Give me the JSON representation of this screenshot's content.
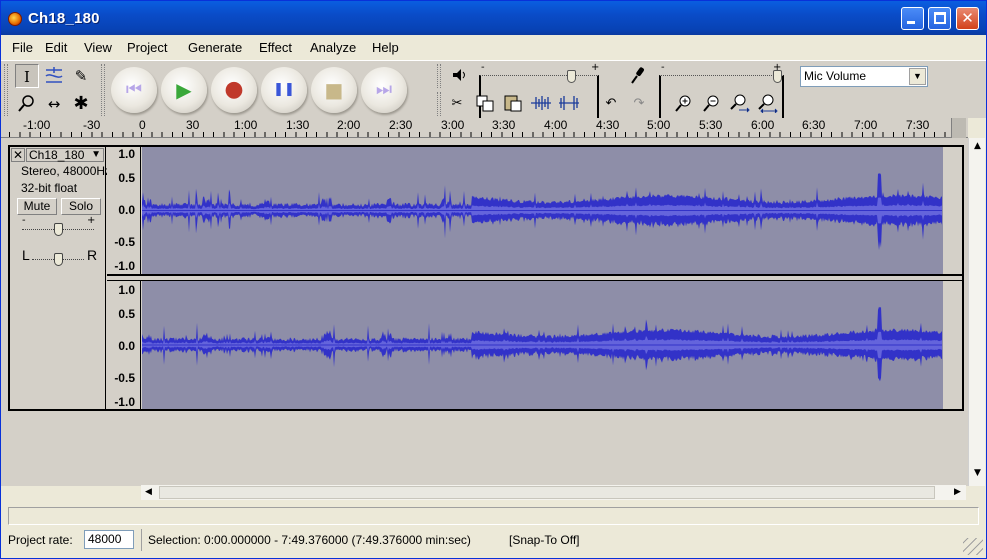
{
  "window": {
    "title": "Ch18_180",
    "app_icon": "audacity-icon",
    "controls": [
      "minimize",
      "maximize",
      "close"
    ]
  },
  "menu": [
    "File",
    "Edit",
    "View",
    "Project",
    "Generate",
    "Effect",
    "Analyze",
    "Help"
  ],
  "tools": [
    {
      "name": "selection-tool",
      "glyph": "I"
    },
    {
      "name": "envelope-tool",
      "glyph": "~"
    },
    {
      "name": "draw-tool",
      "glyph": "✎"
    },
    {
      "name": "zoom-tool",
      "glyph": "⚲"
    },
    {
      "name": "timeshift-tool",
      "glyph": "↔"
    },
    {
      "name": "multi-tool",
      "glyph": "✱"
    }
  ],
  "transport": [
    {
      "name": "skip-start",
      "glyph": "⏮",
      "color": "#b7a6e8"
    },
    {
      "name": "play",
      "glyph": "▶",
      "color": "#3aa83a"
    },
    {
      "name": "record",
      "glyph": "●",
      "color": "#c0392b"
    },
    {
      "name": "pause",
      "glyph": "❚❚",
      "color": "#3a56d8"
    },
    {
      "name": "stop",
      "glyph": "■",
      "color": "#c8b88a"
    },
    {
      "name": "skip-end",
      "glyph": "⏭",
      "color": "#b7a6e8"
    }
  ],
  "mixer": {
    "output_minus": "-",
    "output_plus": "+",
    "input_minus": "-",
    "input_plus": "+",
    "input_source": "Mic Volume",
    "output_level": 0.8,
    "input_level": 1.0
  },
  "edit_tools": [
    "cut-icon",
    "copy-icon",
    "paste-icon",
    "trim-icon",
    "silence-icon",
    "undo-icon",
    "redo-icon",
    "zoom-in-icon",
    "zoom-out-icon",
    "fit-selection-icon",
    "fit-project-icon"
  ],
  "ruler": {
    "labels": [
      "-1:00",
      "-30",
      "0",
      "30",
      "1:00",
      "1:30",
      "2:00",
      "2:30",
      "3:00",
      "3:30",
      "4:00",
      "4:30",
      "5:00",
      "5:30",
      "6:00",
      "6:30",
      "7:00",
      "7:30"
    ]
  },
  "track": {
    "name": "Ch18_180",
    "format": "Stereo, 48000Hz",
    "bits": "32-bit float",
    "mute": "Mute",
    "solo": "Solo",
    "gain_minus": "-",
    "gain_plus": "+",
    "pan_left": "L",
    "pan_right": "R",
    "gain_level": 0.5,
    "pan_level": 0.5,
    "amplitude_labels": [
      "1.0",
      "0.5",
      "0.0",
      "-0.5",
      "-1.0"
    ],
    "wave_color": "#3232c8",
    "wave_bg": "#8e8ea8"
  },
  "status": {
    "rate_label": "Project rate:",
    "rate_value": "48000",
    "selection": "Selection: 0:00.000000 - 7:49.376000 (7:49.376000 min:sec)",
    "snap": "[Snap-To Off]"
  }
}
